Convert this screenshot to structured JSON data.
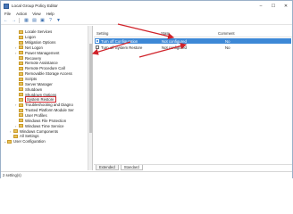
{
  "window": {
    "title": "Local Group Policy Editor"
  },
  "menu": [
    "File",
    "Action",
    "View",
    "Help"
  ],
  "tree": {
    "items": [
      {
        "label": "Locale Services",
        "indent": 2
      },
      {
        "label": "Logon",
        "indent": 2
      },
      {
        "label": "Mitigation Options",
        "indent": 2
      },
      {
        "label": "Net Logon",
        "indent": 2,
        "expandable": true
      },
      {
        "label": "Power Management",
        "indent": 2,
        "expandable": true
      },
      {
        "label": "Recovery",
        "indent": 2
      },
      {
        "label": "Remote Assistance",
        "indent": 2
      },
      {
        "label": "Remote Procedure Call",
        "indent": 2
      },
      {
        "label": "Removable Storage Access",
        "indent": 2
      },
      {
        "label": "Scripts",
        "indent": 2
      },
      {
        "label": "Server Manager",
        "indent": 2
      },
      {
        "label": "Shutdown",
        "indent": 2
      },
      {
        "label": "Shutdown Options",
        "indent": 2
      },
      {
        "label": "System Restore",
        "indent": 2,
        "selected": true
      },
      {
        "label": "Troubleshooting and Diagno",
        "indent": 2,
        "expandable": true
      },
      {
        "label": "Trusted Platform Module Ser",
        "indent": 2
      },
      {
        "label": "User Profiles",
        "indent": 2
      },
      {
        "label": "Windows File Protection",
        "indent": 2
      },
      {
        "label": "Windows Time Service",
        "indent": 2,
        "expandable": true
      },
      {
        "label": "Windows Components",
        "indent": 1,
        "expandable": true
      },
      {
        "label": "All Settings",
        "indent": 1
      },
      {
        "label": "User Configuration",
        "indent": 0,
        "expanded": true
      }
    ]
  },
  "list": {
    "columns": {
      "setting": "Setting",
      "state": "State",
      "comment": "Comment"
    },
    "rows": [
      {
        "setting": "Turn off Configuration",
        "state": "Not configured",
        "comment": "No",
        "selected": true
      },
      {
        "setting": "Turn off System Restore",
        "state": "Not configured",
        "comment": "No",
        "selected": false
      }
    ]
  },
  "tabs": [
    "Extended",
    "Standard"
  ],
  "status": "2 setting(s)",
  "colors": {
    "selection": "#3d88d6",
    "annotation": "#d0232a"
  }
}
